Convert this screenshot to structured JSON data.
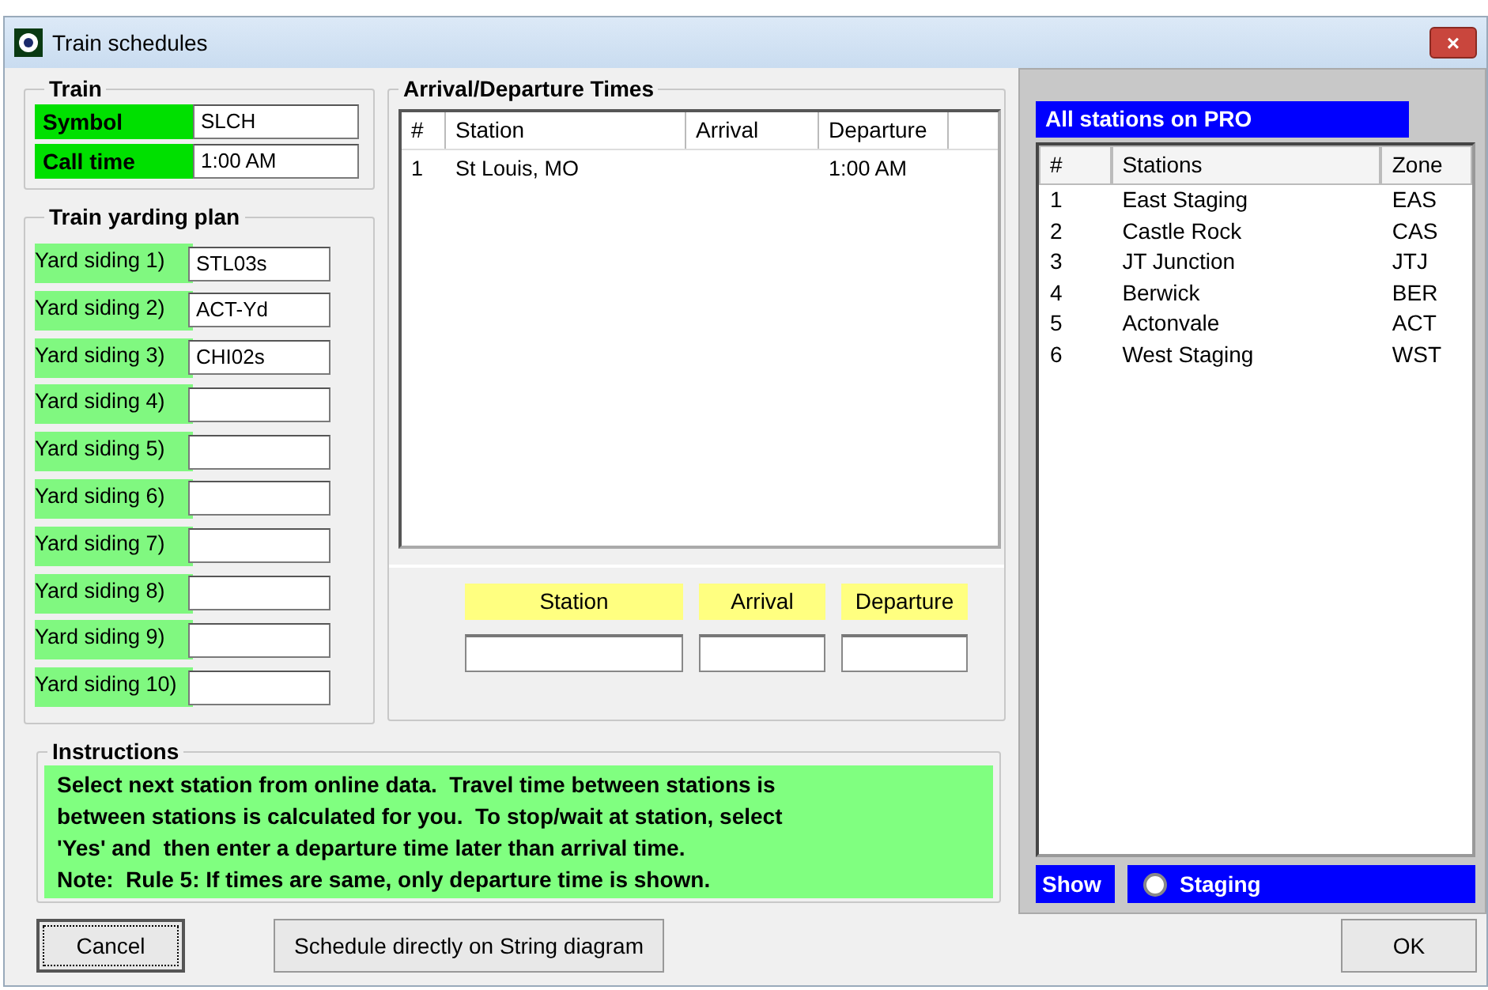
{
  "window": {
    "title": "Train schedules",
    "close": "×"
  },
  "train": {
    "title": "Train",
    "fields": [
      {
        "label": "Symbol",
        "value": "SLCH"
      },
      {
        "label": "Call time",
        "value": "1:00 AM"
      }
    ]
  },
  "yarding_plan": {
    "title": "Train yarding plan",
    "sidings": [
      {
        "label": "Yard siding 1)",
        "value": "STL03s"
      },
      {
        "label": "Yard siding 2)",
        "value": "ACT-Yd"
      },
      {
        "label": "Yard siding 3)",
        "value": "CHI02s"
      },
      {
        "label": "Yard siding 4)"
      },
      {
        "label": "Yard siding 5)"
      },
      {
        "label": "Yard siding 6)"
      },
      {
        "label": "Yard siding 7)"
      },
      {
        "label": "Yard siding 8)"
      },
      {
        "label": "Yard siding 9)"
      },
      {
        "label": "Yard siding 10)"
      }
    ]
  },
  "times": {
    "title": "Arrival/Departure Times",
    "columns": [
      "#",
      "Station",
      "Arrival",
      "Departure"
    ],
    "rows": [
      {
        "cells": [
          "1",
          "St Louis, MO",
          null,
          "1:00 AM"
        ]
      }
    ],
    "entry_labels": [
      "Station",
      "Arrival",
      "Departure"
    ]
  },
  "instructions": {
    "title": "Instructions",
    "lines": [
      "Select next station from online data.  Travel time between stations is",
      "between stations is calculated for you.  To stop/wait at station, select",
      "'Yes' and  then enter a departure time later than arrival time.",
      "Note:  Rule 5: If times are same, only departure time is shown."
    ]
  },
  "stations": {
    "title": "All stations on PRO",
    "columns": [
      "#",
      "Stations",
      "Zone"
    ],
    "rows": [
      {
        "cells": [
          "1",
          "East Staging",
          "EAS"
        ]
      },
      {
        "cells": [
          "2",
          "Castle Rock",
          "CAS"
        ]
      },
      {
        "cells": [
          "3",
          "JT Junction",
          "JTJ"
        ]
      },
      {
        "cells": [
          "4",
          "Berwick",
          "BER"
        ]
      },
      {
        "cells": [
          "5",
          "Actonvale",
          "ACT"
        ]
      },
      {
        "cells": [
          "6",
          "West Staging",
          "WST"
        ]
      }
    ],
    "show_label": "Show",
    "option": {
      "label": "Staging",
      "checked": false
    }
  },
  "buttons": [
    {
      "label": "Cancel",
      "kind": "left"
    },
    {
      "label": "Schedule directly on String diagram",
      "kind": "left"
    },
    {
      "label": "OK",
      "kind": "right"
    }
  ]
}
